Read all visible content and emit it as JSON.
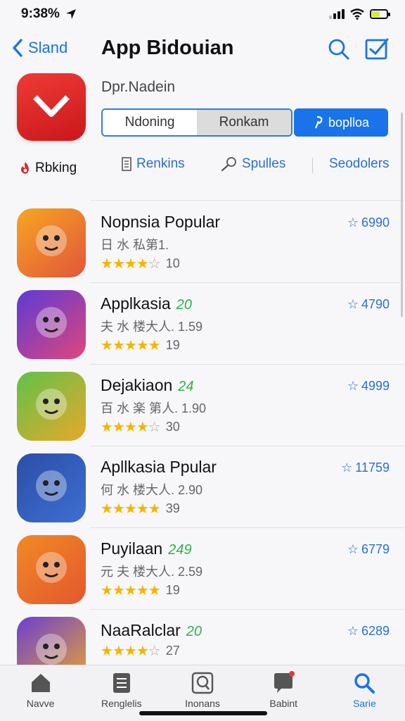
{
  "status": {
    "time": "9:38%"
  },
  "nav": {
    "back_label": "Sland",
    "title": "App Bidouian"
  },
  "header": {
    "subtitle": "Dpr.Nadein",
    "segments": [
      "Ndoning",
      "Ronkam"
    ],
    "primary_button": "boplloa"
  },
  "filters": {
    "ranking": "Rbking",
    "rankins": "Renkins",
    "spulles": "Spulles",
    "seodolers": "Seodolers"
  },
  "apps": [
    {
      "name": "Nopnsia Popular",
      "badge": "",
      "subtitle": "日 水 私第1.",
      "stars": 4,
      "rating_count": "10",
      "score": "6990",
      "colors": [
        "#f6a623",
        "#e2553a"
      ]
    },
    {
      "name": "Applkasia",
      "badge": "20",
      "subtitle": "夫 水 楼大人. 1.59",
      "stars": 5,
      "rating_count": "19",
      "score": "4790",
      "colors": [
        "#5b3bd6",
        "#e0467a"
      ]
    },
    {
      "name": "Dejakiaon",
      "badge": "24",
      "subtitle": "百 水 楽 第人. 1.90",
      "stars": 4,
      "rating_count": "30",
      "score": "4999",
      "colors": [
        "#5fc24a",
        "#e8a82a"
      ]
    },
    {
      "name": "Apllkasia Ppular",
      "badge": "",
      "subtitle": "何 水 楼大人. 2.90",
      "stars": 5,
      "rating_count": "39",
      "score": "11759",
      "colors": [
        "#2b4ea8",
        "#3e6fd1"
      ]
    },
    {
      "name": "Puyilaan",
      "badge": "249",
      "subtitle": "元 夫 楼大人. 2.59",
      "stars": 5,
      "rating_count": "19",
      "score": "6779",
      "colors": [
        "#f08a24",
        "#e4572e"
      ]
    },
    {
      "name": "NaaRalclar",
      "badge": "20",
      "subtitle": "",
      "stars": 4,
      "rating_count": "27",
      "score": "6289",
      "colors": [
        "#6b3fd1",
        "#e9a430"
      ]
    }
  ],
  "tabs": [
    {
      "label": "Navve",
      "icon": "house-icon"
    },
    {
      "label": "Renglelis",
      "icon": "list-icon"
    },
    {
      "label": "Inonans",
      "icon": "search-box-icon"
    },
    {
      "label": "Babint",
      "icon": "chat-icon"
    },
    {
      "label": "Sarie",
      "icon": "search-icon"
    }
  ],
  "colors": {
    "accent": "#1a73e8",
    "star": "#f5b400",
    "badge": "#2db34a"
  }
}
